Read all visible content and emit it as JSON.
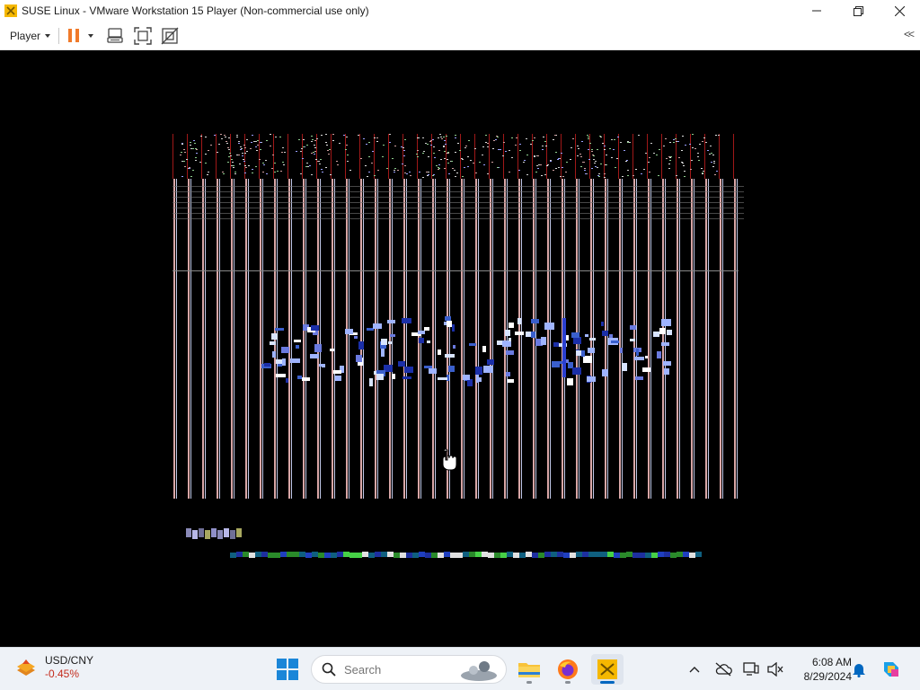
{
  "window": {
    "title": "SUSE Linux - VMware Workstation 15 Player (Non-commercial use only)",
    "controls": {
      "minimize": "minimize",
      "maximize": "maximize",
      "close": "close"
    }
  },
  "toolbar": {
    "player_label": "Player",
    "collapse_label": "<<"
  },
  "vm": {
    "state": "garbled-display"
  },
  "taskbar": {
    "widget": {
      "title": "USD/CNY",
      "change": "-0.45%",
      "change_color": "#c42b1c"
    },
    "search_placeholder": "Search",
    "clock": {
      "time": "6:08 AM",
      "date": "8/29/2024"
    }
  },
  "colors": {
    "accent": "#0067c0",
    "pause_orange": "#f07a2a",
    "vmware_yellow": "#f5b800"
  }
}
